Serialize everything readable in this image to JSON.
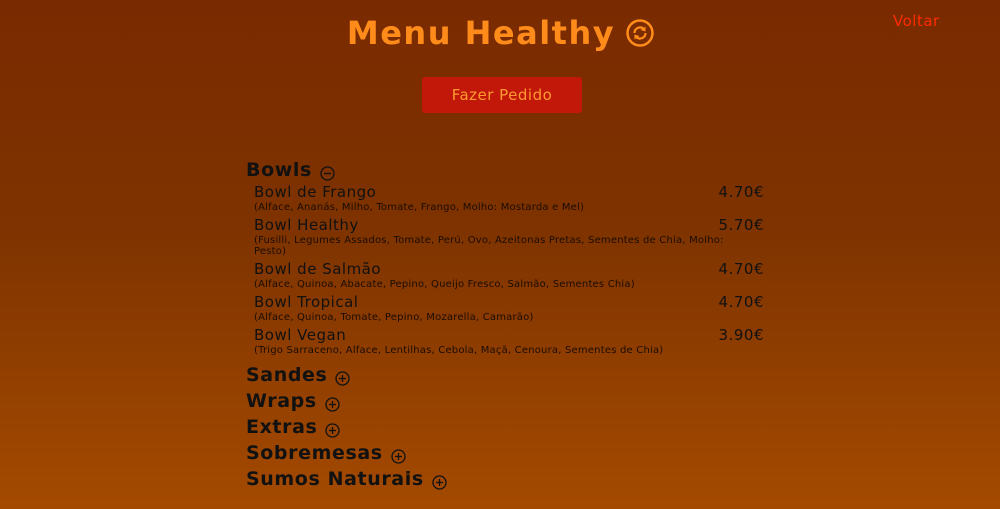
{
  "nav": {
    "back_label": "Voltar"
  },
  "header": {
    "title": "Menu Healthy",
    "icon": "refresh-icon"
  },
  "order_button_label": "Fazer Pedido",
  "colors": {
    "title": "#ff8c1a",
    "button_bg": "#c2180a",
    "button_text": "#ff9a30",
    "back_link": "#ff2a00"
  },
  "categories": [
    {
      "name": "Bowls",
      "expanded": true,
      "icon": "minus-circle-icon",
      "items": [
        {
          "name": "Bowl de Frango",
          "price": "4.70€",
          "description": "(Alface, Ananás, Milho, Tomate, Frango, Molho: Mostarda e Mel)"
        },
        {
          "name": "Bowl Healthy",
          "price": "5.70€",
          "description": "(Fusilli, Legumes Assados, Tomate, Perú, Ovo, Azeitonas Pretas, Sementes de Chia, Molho: Pesto)"
        },
        {
          "name": "Bowl de Salmão",
          "price": "4.70€",
          "description": "(Alface, Quinoa, Abacate, Pepino, Queijo Fresco, Salmão, Sementes Chia)"
        },
        {
          "name": "Bowl Tropical",
          "price": "4.70€",
          "description": "(Alface, Quinoa, Tomate, Pepino, Mozarella, Camarão)"
        },
        {
          "name": "Bowl Vegan",
          "price": "3.90€",
          "description": "(Trigo Sarraceno, Alface, Lentilhas, Cebola, Maçã, Cenoura, Sementes de Chia)"
        }
      ]
    },
    {
      "name": "Sandes",
      "expanded": false,
      "icon": "plus-circle-icon"
    },
    {
      "name": "Wraps",
      "expanded": false,
      "icon": "plus-circle-icon"
    },
    {
      "name": "Extras",
      "expanded": false,
      "icon": "plus-circle-icon"
    },
    {
      "name": "Sobremesas",
      "expanded": false,
      "icon": "plus-circle-icon"
    },
    {
      "name": "Sumos Naturais",
      "expanded": false,
      "icon": "plus-circle-icon"
    }
  ]
}
